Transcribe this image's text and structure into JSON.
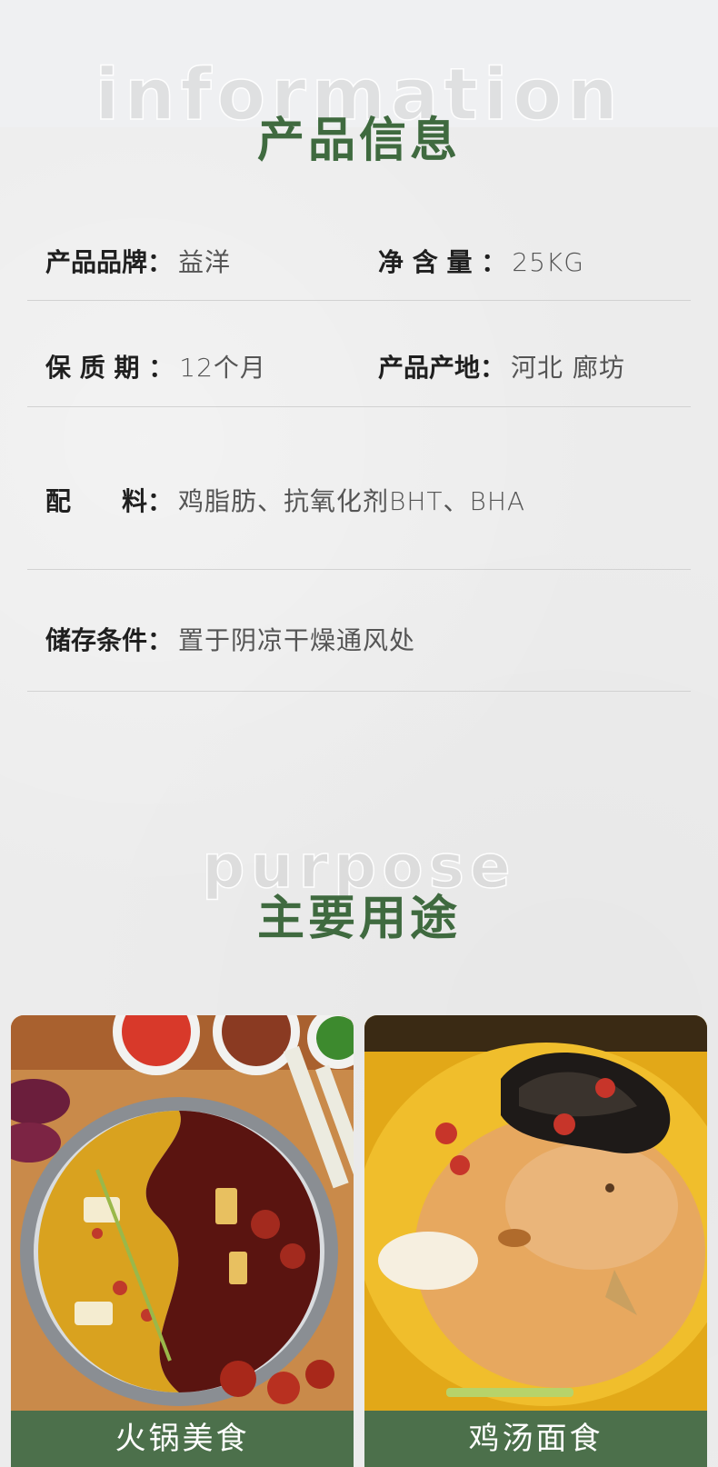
{
  "info_section": {
    "bg_word": "information",
    "title": "产品信息"
  },
  "product_info": {
    "brand": {
      "label": "产品品牌：",
      "value": "益洋"
    },
    "net_content": {
      "label": "净 含 量 ：",
      "value": "25KG"
    },
    "shelf_life": {
      "label": "保 质 期 ：",
      "value": "12个月"
    },
    "origin": {
      "label": "产品产地：",
      "value": "河北 廊坊"
    },
    "ingredients": {
      "label": "配　　料：",
      "value": "鸡脂肪、抗氧化剂BHT、BHA"
    },
    "storage": {
      "label": "储存条件：",
      "value": "置于阴凉干燥通风处"
    }
  },
  "purpose_section": {
    "bg_word": "purpose",
    "title": "主要用途"
  },
  "uses": [
    {
      "caption": "火锅美食",
      "image": "hotpot-photo"
    },
    {
      "caption": "鸡汤面食",
      "image": "chicken-soup-photo"
    }
  ],
  "colors": {
    "title_green": "#3f6a3f",
    "caption_bar": "#4c704b",
    "divider": "#d2d2d2"
  }
}
